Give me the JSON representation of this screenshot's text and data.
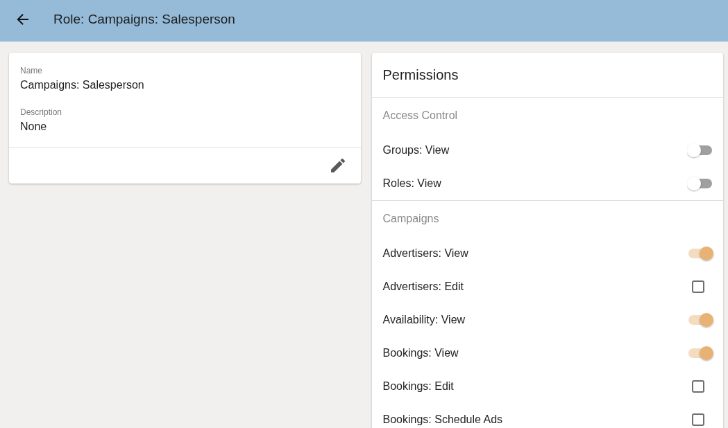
{
  "app_bar": {
    "title": "Role: Campaigns: Salesperson"
  },
  "details": {
    "fields": [
      {
        "label": "Name",
        "value": "Campaigns: Salesperson"
      },
      {
        "label": "Description",
        "value": "None"
      }
    ]
  },
  "permissions": {
    "title": "Permissions",
    "sections": [
      {
        "title": "Access Control",
        "items": [
          {
            "label": "Groups: View",
            "kind": "toggle",
            "checked": false
          },
          {
            "label": "Roles: View",
            "kind": "toggle",
            "checked": false
          }
        ]
      },
      {
        "title": "Campaigns",
        "items": [
          {
            "label": "Advertisers: View",
            "kind": "toggle",
            "checked": true
          },
          {
            "label": "Advertisers: Edit",
            "kind": "checkbox",
            "checked": false
          },
          {
            "label": "Availability: View",
            "kind": "toggle",
            "checked": true
          },
          {
            "label": "Bookings: View",
            "kind": "toggle",
            "checked": true
          },
          {
            "label": "Bookings: Edit",
            "kind": "checkbox",
            "checked": false
          },
          {
            "label": "Bookings: Schedule Ads",
            "kind": "checkbox",
            "checked": false
          }
        ]
      }
    ]
  }
}
